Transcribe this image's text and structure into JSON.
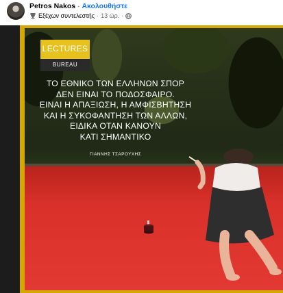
{
  "post": {
    "author": "Petros Nakos",
    "separator": "·",
    "follow_label": "Ακολουθήστε",
    "badge_label": "Εξέχων συντελεστής",
    "time_separator": "·",
    "time": "13 ώρ.",
    "meta_separator": "·"
  },
  "image": {
    "brand_top": "LECTURES",
    "brand_bottom": "BUREAU",
    "quote_lines": [
      "ΤΟ ΕΘΝΙΚΟ ΤΩΝ ΕΛΛΗΝΩΝ ΣΠΟΡ",
      "ΔΕΝ ΕΙΝΑΙ ΤΟ ΠΟΔΟΣΦΑΙΡΟ.",
      "ΕΙΝΑΙ Η ΑΠΑΞΙΩΣΗ, Η ΑΜΦΙΣΒΗΤΗΣΗ",
      "ΚΑΙ Η ΣΥΚΟΦΑΝΤΗΣΗ ΤΩΝ ΑΛΛΩΝ,",
      "ΕΙΔΙΚΑ ΟΤΑΝ ΚΑΝΟΥΝ",
      "ΚΑΤΙ ΣΗΜΑΝΤΙΚΟ"
    ],
    "quote_author": "ΓΙΑΝΝΗΣ ΤΣΑΡΟΥΧΗΣ"
  },
  "colors": {
    "follow": "#1877f2",
    "frame": "#d4a800",
    "stage": "#d9302a"
  }
}
